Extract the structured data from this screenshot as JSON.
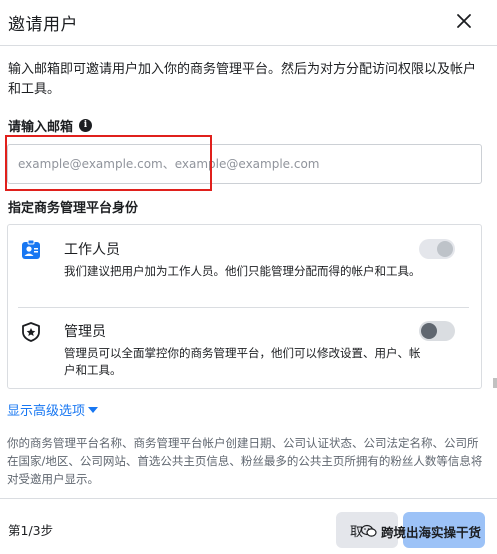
{
  "dialog": {
    "title": "邀请用户",
    "description": "输入邮箱即可邀请用户加入你的商务管理平台。然后为对方分配访问权限以及帐户和工具。",
    "email": {
      "label": "请输入邮箱",
      "placeholder": "example@example.com、example@example.com",
      "value": ""
    },
    "role_section_label": "指定商务管理平台身份",
    "roles": [
      {
        "title": "工作人员",
        "description": "我们建议把用户加为工作人员。他们只能管理分配而得的帐户和工具。",
        "icon": "employee-badge-icon",
        "toggle_state": "on-disabled"
      },
      {
        "title": "管理员",
        "description": "管理员可以全面掌控你的商务管理平台，他们可以修改设置、用户、帐户和工具。",
        "icon": "admin-shield-icon",
        "toggle_state": "off"
      }
    ],
    "advanced_link": "显示高级选项",
    "notice": "你的商务管理平台名称、商务管理平台帐户创建日期、公司认证状态、公司法定名称、公司所在国家/地区、公司网站、首选公共主页信息、粉丝最多的公共主页所拥有的粉丝人数等信息将对受邀用户显示。",
    "step": "第1/3步",
    "cancel_label": "取",
    "watermark": "跨境出海实操干货"
  },
  "colors": {
    "accent": "#1877f2",
    "highlight_box": "#e0201c",
    "next_button": "#9cc2f7"
  }
}
